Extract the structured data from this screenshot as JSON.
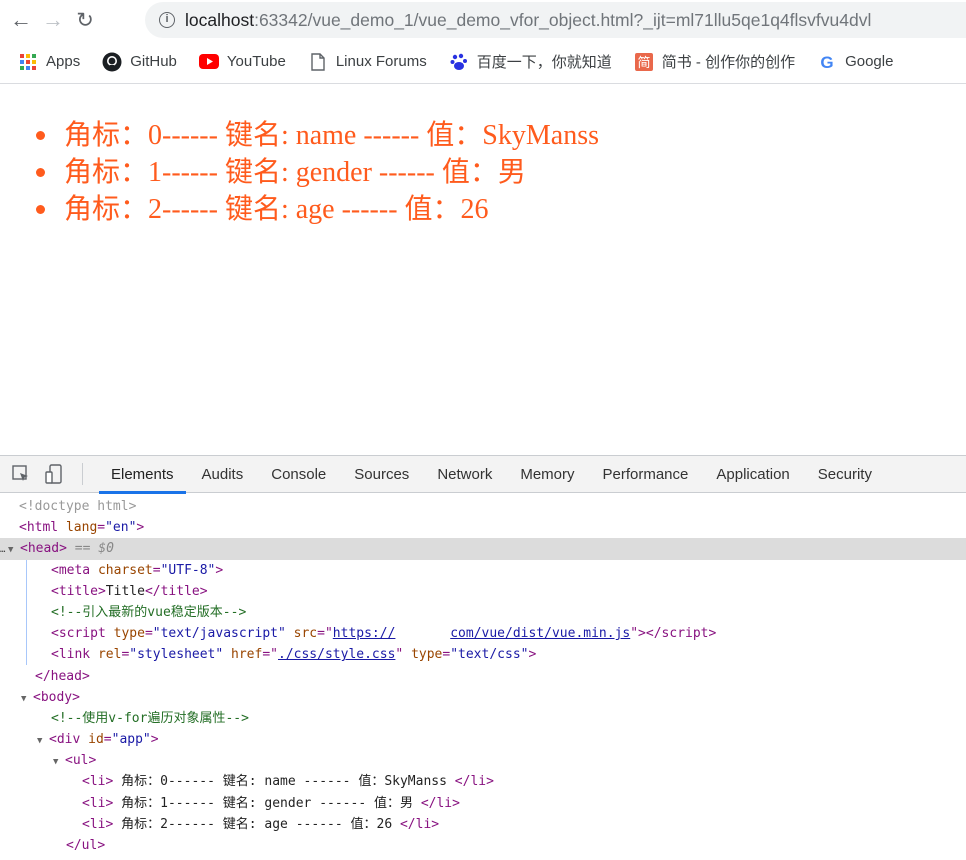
{
  "browser": {
    "url_host": "localhost",
    "url_rest": ":63342/vue_demo_1/vue_demo_vfor_object.html?_ijt=ml71llu5qe1q4flsvfvu4dvl",
    "bookmarks": [
      {
        "label": "Apps",
        "icon": "apps-grid-icon"
      },
      {
        "label": "GitHub",
        "icon": "github-icon"
      },
      {
        "label": "YouTube",
        "icon": "youtube-icon"
      },
      {
        "label": "Linux Forums",
        "icon": "page-icon"
      },
      {
        "label": "百度一下，你就知道",
        "icon": "baidu-icon"
      },
      {
        "label": "简书 - 创作你的创作",
        "icon": "jianshu-icon"
      },
      {
        "label": "Google",
        "icon": "google-icon"
      }
    ]
  },
  "page": {
    "items": [
      "角标：0------ 键名: name ------ 值：SkyManss",
      "角标：1------ 键名: gender ------ 值：男",
      "角标：2------ 键名: age ------ 值：26"
    ],
    "text_color": "#ff5b1d"
  },
  "devtools": {
    "tabs": [
      "Elements",
      "Audits",
      "Console",
      "Sources",
      "Network",
      "Memory",
      "Performance",
      "Application",
      "Security"
    ],
    "active_tab": "Elements",
    "code": {
      "doctype": "<!doctype html>",
      "html_open": "html",
      "html_lang_attr": "lang",
      "html_lang_val": "\"en\"",
      "head": "head",
      "head_eq": "== $0",
      "meta": "meta",
      "meta_attr": "charset",
      "meta_val": "\"UTF-8\"",
      "title_tag": "title",
      "title_text": "Title",
      "comment1": "<!--引入最新的vue稳定版本-->",
      "script_tag": "script",
      "script_type_attr": "type",
      "script_type_val": "\"text/javascript\"",
      "script_src_attr": "src",
      "script_src_part1": "https://",
      "script_src_part2": "com/vue/dist/vue.min.js",
      "link_tag": "link",
      "link_rel_attr": "rel",
      "link_rel_val": "\"stylesheet\"",
      "link_href_attr": "href",
      "link_href_val": "./css/style.css",
      "link_type_attr": "type",
      "link_type_val": "\"text/css\"",
      "head_close": "head",
      "body": "body",
      "comment2": "<!--使用v-for遍历对象属性-->",
      "div_tag": "div",
      "div_id_attr": "id",
      "div_id_val": "\"app\"",
      "ul_tag": "ul",
      "li_tag": "li",
      "li_items": [
        " 角标：0------ 键名: name ------ 值：SkyManss ",
        " 角标：1------ 键名: gender ------ 值：男 ",
        " 角标：2------ 键名: age ------ 值：26 "
      ]
    }
  }
}
